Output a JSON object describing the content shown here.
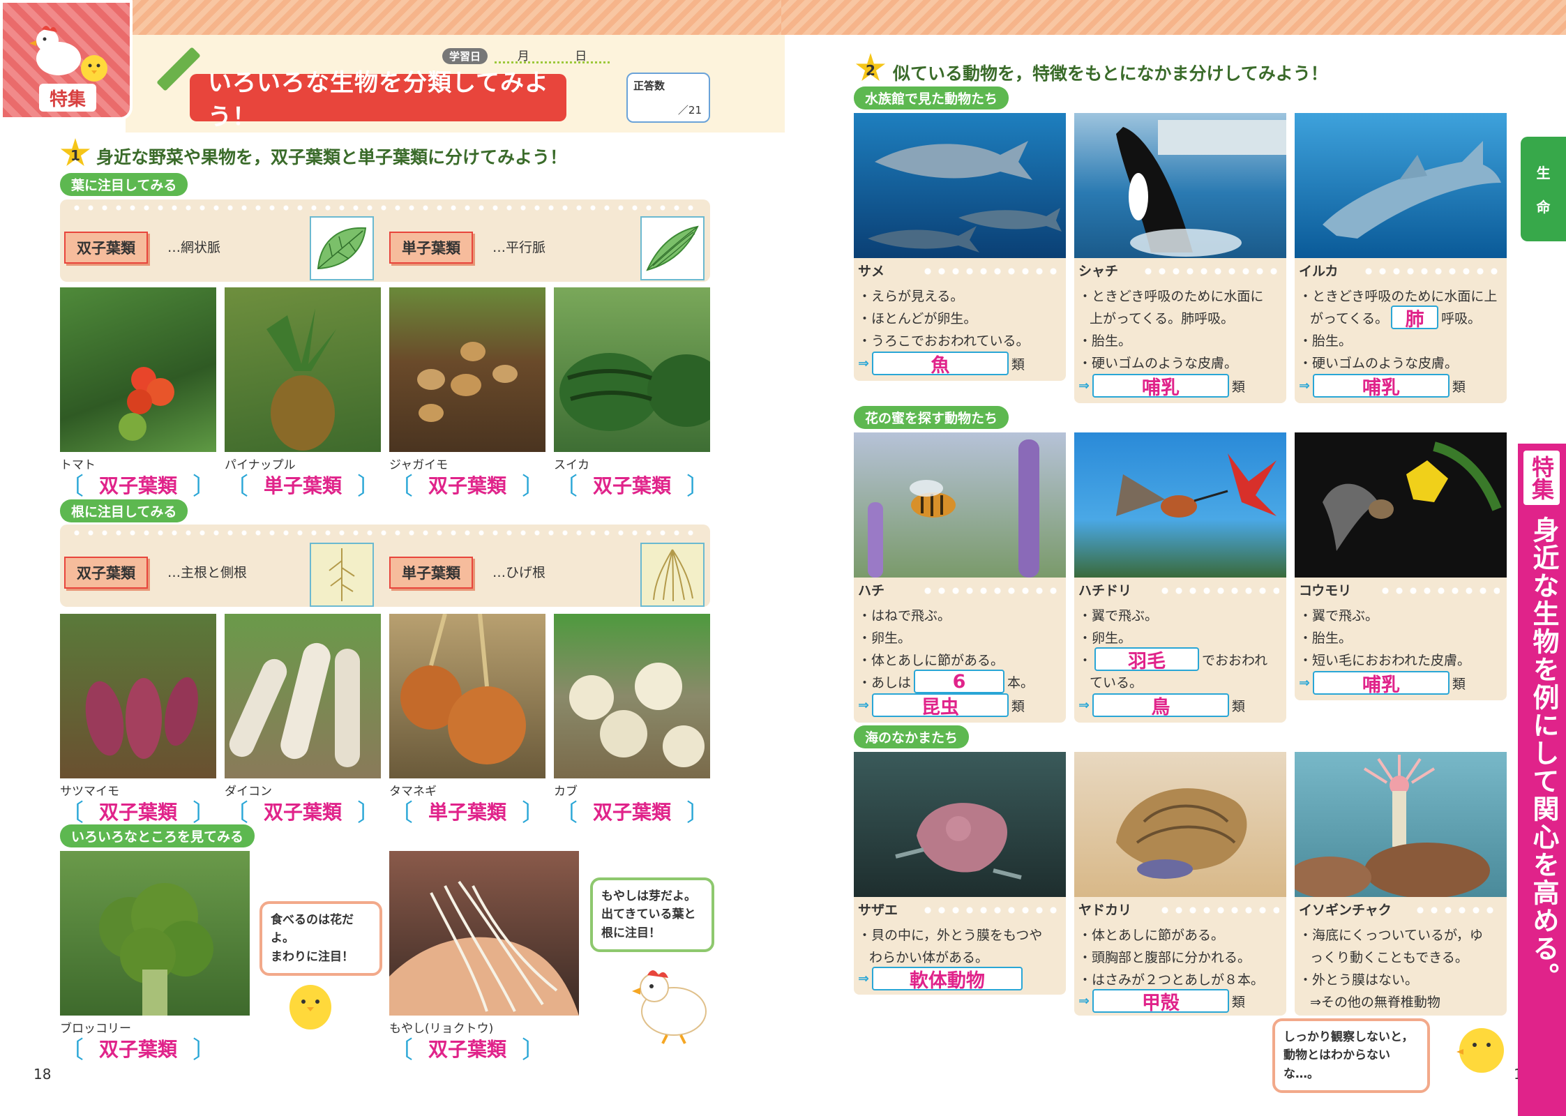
{
  "header": {
    "badge": "特集",
    "title": "いろいろな生物を分類してみよう！",
    "study_day_label": "学習日",
    "month": "月",
    "day": "日",
    "score_label": "正答数",
    "score_total": "／21"
  },
  "q1": {
    "num": "1",
    "text": "身近な野菜や果物を，双子葉類と単子葉類に分けてみよう！",
    "leaf_section": "葉に注目してみる",
    "root_section": "根に注目してみる",
    "misc_section": "いろいろなところを見てみる",
    "leaf_types": [
      {
        "label": "双子葉類",
        "desc": "…網状脈"
      },
      {
        "label": "単子葉類",
        "desc": "…平行脈"
      }
    ],
    "root_types": [
      {
        "label": "双子葉類",
        "desc": "…主根と側根"
      },
      {
        "label": "単子葉類",
        "desc": "…ひげ根"
      }
    ],
    "leaf_items": [
      {
        "name": "トマト",
        "answer": "双子葉類"
      },
      {
        "name": "パイナップル",
        "answer": "単子葉類"
      },
      {
        "name": "ジャガイモ",
        "answer": "双子葉類"
      },
      {
        "name": "スイカ",
        "answer": "双子葉類"
      }
    ],
    "root_items": [
      {
        "name": "サツマイモ",
        "answer": "双子葉類"
      },
      {
        "name": "ダイコン",
        "answer": "双子葉類"
      },
      {
        "name": "タマネギ",
        "answer": "単子葉類"
      },
      {
        "name": "カブ",
        "answer": "双子葉類"
      }
    ],
    "misc_items": [
      {
        "name": "ブロッコリー",
        "answer": "双子葉類"
      },
      {
        "name": "もやし(リョクトウ)",
        "answer": "双子葉類"
      }
    ],
    "bubble_broccoli": [
      "食べるのは花だよ。",
      "まわりに注目！"
    ],
    "bubble_moyashi": [
      "もやしは芽だよ。",
      "出てきている葉と",
      "根に注目！"
    ]
  },
  "q2": {
    "num": "2",
    "text": "似ている動物を，特徴をもとになかま分けしてみよう！",
    "group1": "水族館で見た動物たち",
    "group2": "花の蜜を探す動物たち",
    "group3": "海のなかまたち",
    "animals": {
      "same": {
        "name": "サメ",
        "l1": "・えらが見える。",
        "l2": "・ほとんどが卵生。",
        "l3": "・うろこでおおわれている。",
        "answer": "魚",
        "suffix": "類"
      },
      "shachi": {
        "name": "シャチ",
        "l1": "・ときどき呼吸のために水面に",
        "l2": "上がってくる。肺呼吸。",
        "l3": "・胎生。",
        "l4": "・硬いゴムのような皮膚。",
        "answer": "哺乳",
        "suffix": "類"
      },
      "iruka": {
        "name": "イルカ",
        "l1": "・ときどき呼吸のために水面に上",
        "l2a": "がってくる。",
        "l2_answer": "肺",
        "l2b": "呼吸。",
        "l3": "・胎生。",
        "l4": "・硬いゴムのような皮膚。",
        "answer": "哺乳",
        "suffix": "類"
      },
      "hachi": {
        "name": "ハチ",
        "l1": "・はねで飛ぶ。",
        "l2": "・卵生。",
        "l3": "・体とあしに節がある。",
        "l4a": "・あしは",
        "l4_answer": "6",
        "l4b": "本。",
        "answer": "昆虫",
        "suffix": "類"
      },
      "hachidori": {
        "name": "ハチドリ",
        "l1": "・翼で飛ぶ。",
        "l2": "・卵生。",
        "l3a": "・",
        "l3_answer": "羽毛",
        "l3b": "でおおわれ",
        "l4": "ている。",
        "answer": "鳥",
        "suffix": "類"
      },
      "koumori": {
        "name": "コウモリ",
        "l1": "・翼で飛ぶ。",
        "l2": "・胎生。",
        "l3": "・短い毛におおわれた皮膚。",
        "answer": "哺乳",
        "suffix": "類"
      },
      "sazae": {
        "name": "サザエ",
        "l1": "・貝の中に，外とう膜をもつや",
        "l2": "わらかい体がある。",
        "answer": "軟体動物"
      },
      "yadokari": {
        "name": "ヤドカリ",
        "l1": "・体とあしに節がある。",
        "l2": "・頭胸部と腹部に分かれる。",
        "l3": "・はさみが２つとあしが８本。",
        "answer": "甲殻",
        "suffix": "類"
      },
      "isoginchaku": {
        "name": "イソギンチャク",
        "l1": "・海底にくっついているが，ゆ",
        "l2": "っくり動くこともできる。",
        "l3": "・外とう膜はない。",
        "l4": "⇒その他の無脊椎動物"
      }
    },
    "arrow": "⇒",
    "bubble_chick": [
      "しっかり観察しないと，",
      "動物とはわからないな…。"
    ]
  },
  "side": {
    "green_tab_1": "生",
    "green_tab_2": "命",
    "pink_tag": "特集",
    "pink_text": "身近な生物を例にして関心を高める。"
  },
  "pages": {
    "left": "18",
    "right": "1"
  },
  "brackets": {
    "open": "〔",
    "close": "〕"
  }
}
